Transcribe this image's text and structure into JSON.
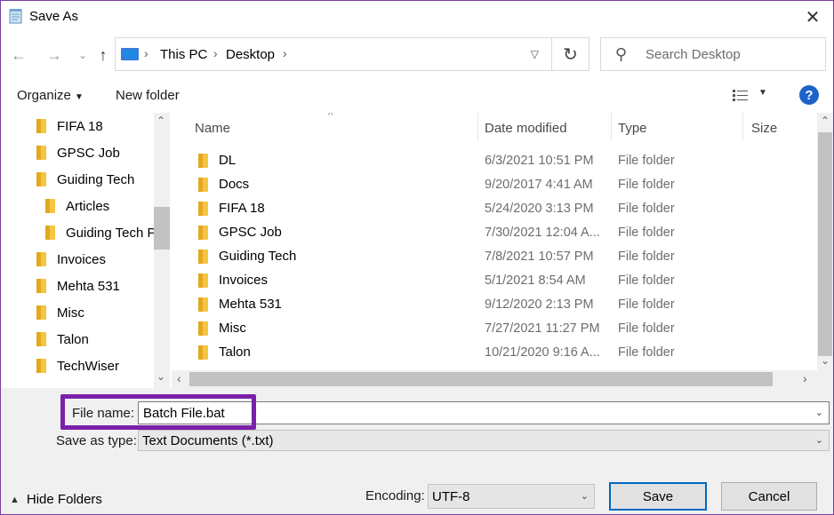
{
  "window": {
    "title": "Save As",
    "close_icon": "close-icon"
  },
  "address": {
    "crumbs": [
      "This PC",
      "Desktop"
    ],
    "search_placeholder": "Search Desktop"
  },
  "toolbar": {
    "organize_label": "Organize",
    "new_folder_label": "New folder",
    "help_label": "?"
  },
  "nav_pane": {
    "items": [
      {
        "label": "FIFA 18",
        "indent": 0
      },
      {
        "label": "GPSC Job",
        "indent": 0
      },
      {
        "label": "Guiding Tech",
        "indent": 0
      },
      {
        "label": "Articles",
        "indent": 1
      },
      {
        "label": "Guiding Tech P",
        "indent": 1
      },
      {
        "label": "Invoices",
        "indent": 0
      },
      {
        "label": "Mehta 531",
        "indent": 0
      },
      {
        "label": "Misc",
        "indent": 0
      },
      {
        "label": "Talon",
        "indent": 0
      },
      {
        "label": "TechWiser",
        "indent": 0
      }
    ]
  },
  "file_list": {
    "columns": [
      "Name",
      "Date modified",
      "Type",
      "Size"
    ],
    "rows": [
      {
        "name": "DL",
        "date": "6/3/2021 10:51 PM",
        "type": "File folder"
      },
      {
        "name": "Docs",
        "date": "9/20/2017 4:41 AM",
        "type": "File folder"
      },
      {
        "name": "FIFA 18",
        "date": "5/24/2020 3:13 PM",
        "type": "File folder"
      },
      {
        "name": "GPSC Job",
        "date": "7/30/2021 12:04 A...",
        "type": "File folder"
      },
      {
        "name": "Guiding Tech",
        "date": "7/8/2021 10:57 PM",
        "type": "File folder"
      },
      {
        "name": "Invoices",
        "date": "5/1/2021 8:54 AM",
        "type": "File folder"
      },
      {
        "name": "Mehta 531",
        "date": "9/12/2020 2:13 PM",
        "type": "File folder"
      },
      {
        "name": "Misc",
        "date": "7/27/2021 11:27 PM",
        "type": "File folder"
      },
      {
        "name": "Talon",
        "date": "10/21/2020 9:16 A...",
        "type": "File folder"
      }
    ]
  },
  "save_form": {
    "file_name_label": "File name:",
    "file_name_value": "Batch File.bat",
    "save_type_label": "Save as type:",
    "save_type_value": "Text Documents (*.txt)",
    "encoding_label": "Encoding:",
    "encoding_value": "UTF-8",
    "save_label": "Save",
    "cancel_label": "Cancel",
    "hide_folders_label": "Hide Folders"
  },
  "colors": {
    "highlight": "#7b20a8",
    "accent": "#0067c0",
    "folder": "#f5c542"
  }
}
